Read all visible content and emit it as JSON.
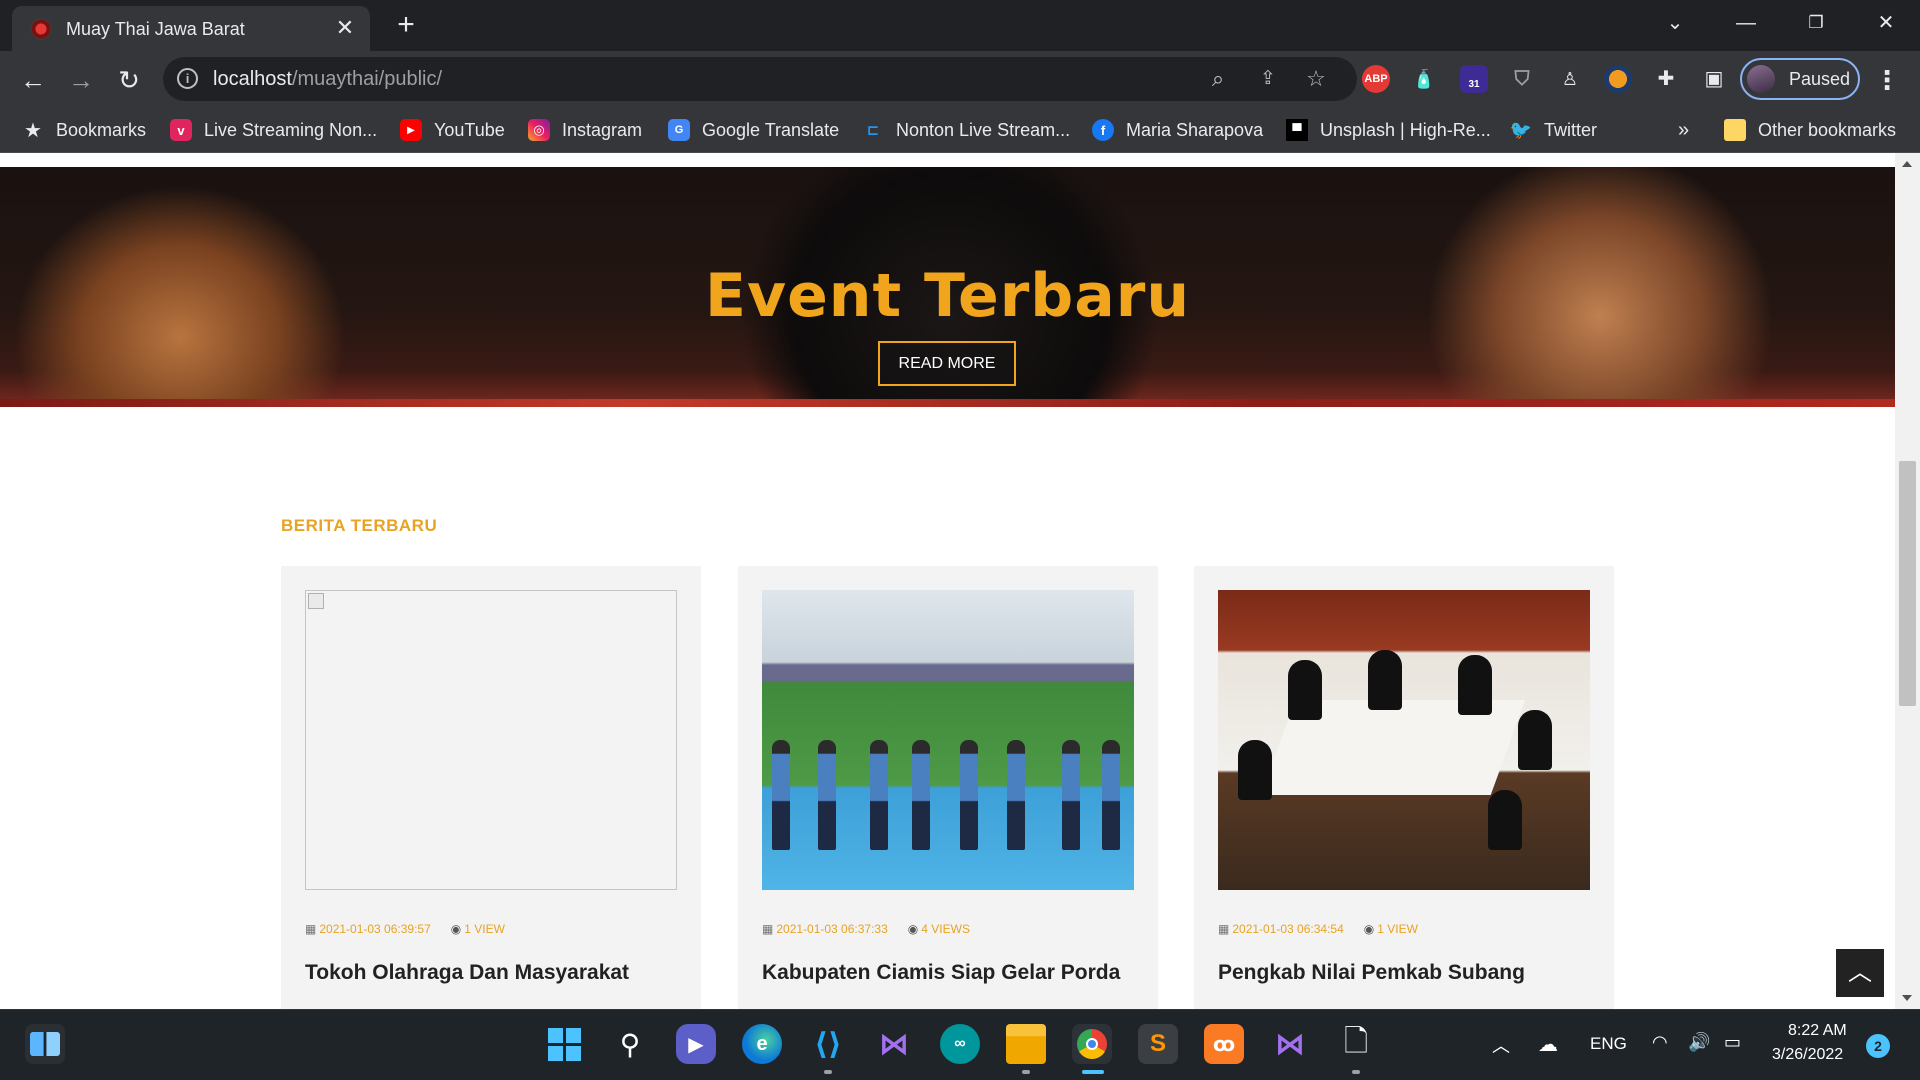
{
  "browser": {
    "tab_title": "Muay Thai Jawa Barat",
    "tab_close": "✕",
    "new_tab": "+",
    "url_host": "localhost",
    "url_path": "/muaythai/public/",
    "profile_label": "Paused",
    "extensions": [
      {
        "name": "adblock-plus-icon",
        "label": "ABP",
        "color": "#e53935"
      },
      {
        "name": "badge-count-icon",
        "label": "31",
        "color": "#3f2b96"
      }
    ]
  },
  "bookmarks": [
    {
      "label": "Bookmarks",
      "icon": "star-icon"
    },
    {
      "label": "Live Streaming Non...",
      "icon": "vidio-icon"
    },
    {
      "label": "YouTube",
      "icon": "youtube-icon"
    },
    {
      "label": "Instagram",
      "icon": "instagram-icon"
    },
    {
      "label": "Google Translate",
      "icon": "google-translate-icon"
    },
    {
      "label": "Nonton Live Stream...",
      "icon": "stream-icon"
    },
    {
      "label": "Maria Sharapova",
      "icon": "facebook-icon"
    },
    {
      "label": "Unsplash | High-Re...",
      "icon": "unsplash-icon"
    },
    {
      "label": "Twitter",
      "icon": "twitter-icon"
    }
  ],
  "bookmarks_overflow": "»",
  "other_bookmarks": "Other bookmarks",
  "hero": {
    "title": "Event Terbaru",
    "button": "READ MORE"
  },
  "section_label": "BERITA TERBARU",
  "news": [
    {
      "date": "2021-01-03 06:39:57",
      "views": "1 VIEW",
      "title": "Tokoh Olahraga Dan Masyarakat"
    },
    {
      "date": "2021-01-03 06:37:33",
      "views": "4 VIEWS",
      "title": "Kabupaten Ciamis Siap Gelar Porda"
    },
    {
      "date": "2021-01-03 06:34:54",
      "views": "1 VIEW",
      "title": "Pengkab Nilai Pemkab Subang"
    }
  ],
  "scroll_top_label": "︿",
  "taskbar": {
    "language": "ENG",
    "time": "8:22 AM",
    "date": "3/26/2022",
    "notifications": "2"
  }
}
